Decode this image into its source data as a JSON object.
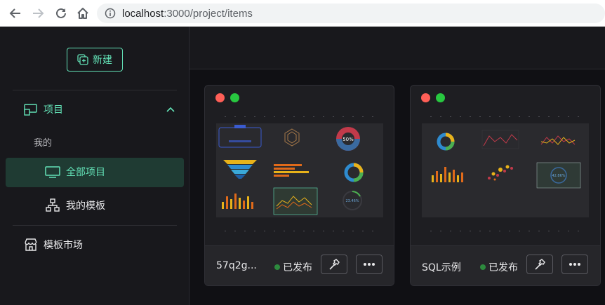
{
  "browser": {
    "url_host": "localhost",
    "url_path": ":3000/project/items"
  },
  "sidebar": {
    "new_button_label": "新建",
    "menu": {
      "project_label": "项目",
      "mine_label": "我的",
      "all_projects_label": "全部项目",
      "my_templates_label": "我的模板",
      "template_market_label": "模板市场"
    }
  },
  "projects": [
    {
      "title": "57q2g...",
      "status": "已发布"
    },
    {
      "title": "SQL示例",
      "status": "已发布"
    }
  ],
  "colors": {
    "accent": "#63e2b7",
    "dot_red": "#ff5f57",
    "dot_green": "#28c840",
    "status_green": "#2d8a3e"
  },
  "thumbnail_texts": {
    "card1_donut": "50%",
    "card1_ring": "23.46%",
    "card2_ring": "42.86%"
  }
}
